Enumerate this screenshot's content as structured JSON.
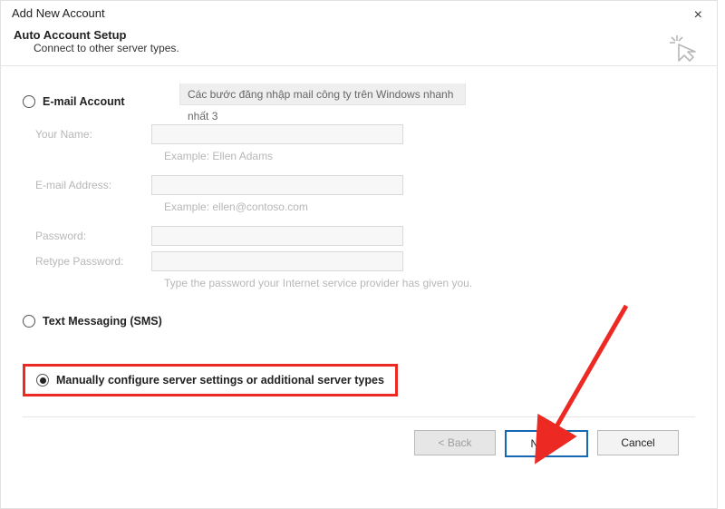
{
  "window": {
    "title": "Add New Account"
  },
  "header": {
    "title": "Auto Account Setup",
    "subtitle": "Connect to other server types."
  },
  "tooltip": {
    "text": "Các bước đăng nhập mail công ty trên Windows nhanh nhất 3"
  },
  "options": {
    "email": "E-mail Account",
    "sms": "Text Messaging (SMS)",
    "manual": "Manually configure server settings or additional server types",
    "selected": "manual"
  },
  "form": {
    "name_label": "Your Name:",
    "name_hint": "Example: Ellen Adams",
    "email_label": "E-mail Address:",
    "email_hint": "Example: ellen@contoso.com",
    "password_label": "Password:",
    "retype_label": "Retype Password:",
    "password_hint": "Type the password your Internet service provider has given you."
  },
  "buttons": {
    "back": "< Back",
    "next": "Next >",
    "cancel": "Cancel"
  }
}
